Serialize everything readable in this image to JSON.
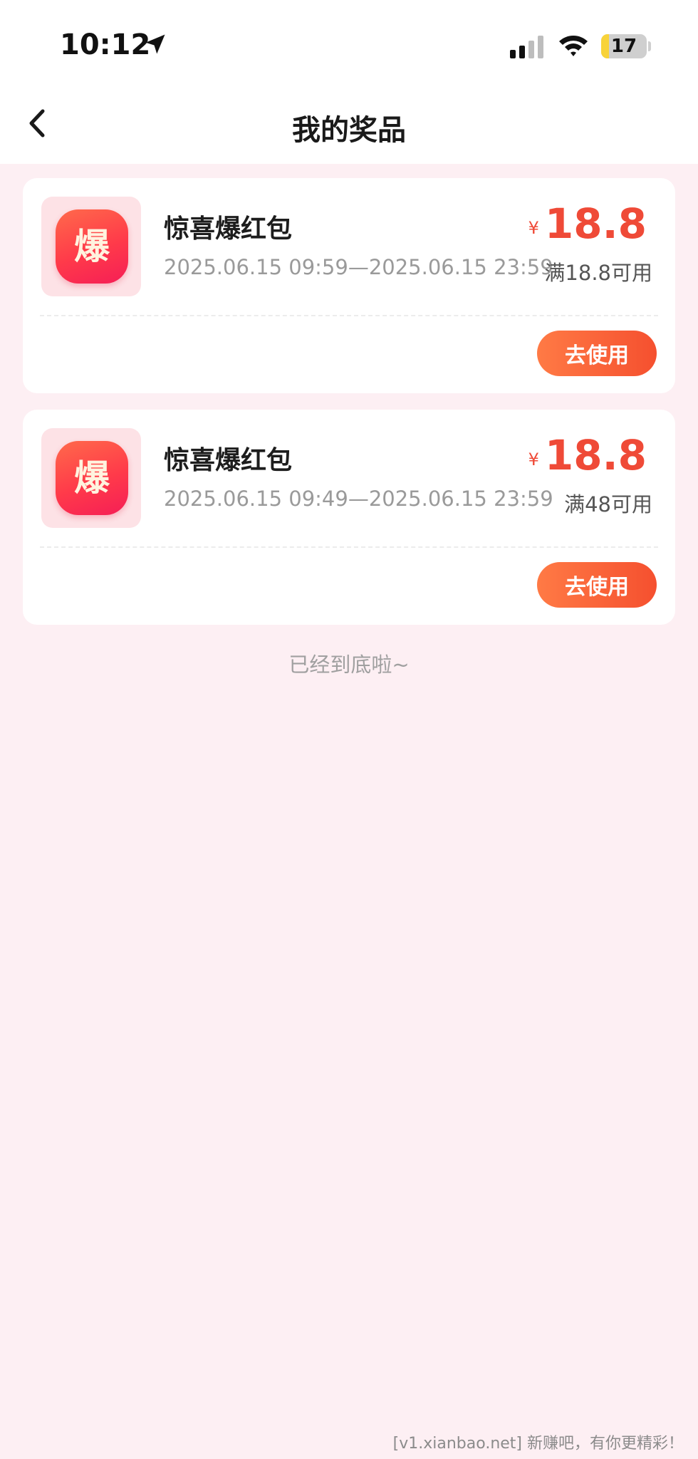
{
  "status_bar": {
    "time": "10:12",
    "battery": "17",
    "battery_level_percent": 17,
    "icons": [
      "location-arrow-icon",
      "cellular-signal-icon",
      "wifi-icon",
      "battery-icon"
    ]
  },
  "nav": {
    "title": "我的奖品",
    "back_icon": "chevron-left-icon"
  },
  "prizes": [
    {
      "icon_glyph": "爆",
      "name": "惊喜爆红包",
      "period": "2025.06.15 09:59—2025.06.15 23:59",
      "currency": "¥",
      "amount": "18.8",
      "condition": "满18.8可用",
      "button_label": "去使用"
    },
    {
      "icon_glyph": "爆",
      "name": "惊喜爆红包",
      "period": "2025.06.15 09:49—2025.06.15 23:59",
      "currency": "¥",
      "amount": "18.8",
      "condition": "满48可用",
      "button_label": "去使用"
    }
  ],
  "end_of_list": "已经到底啦~",
  "watermark": "[v1.xianbao.net] 新赚吧，有你更精彩！",
  "colors": {
    "background": "#fdeff3",
    "accent": "#ef4a37",
    "button": "#f5502f"
  }
}
